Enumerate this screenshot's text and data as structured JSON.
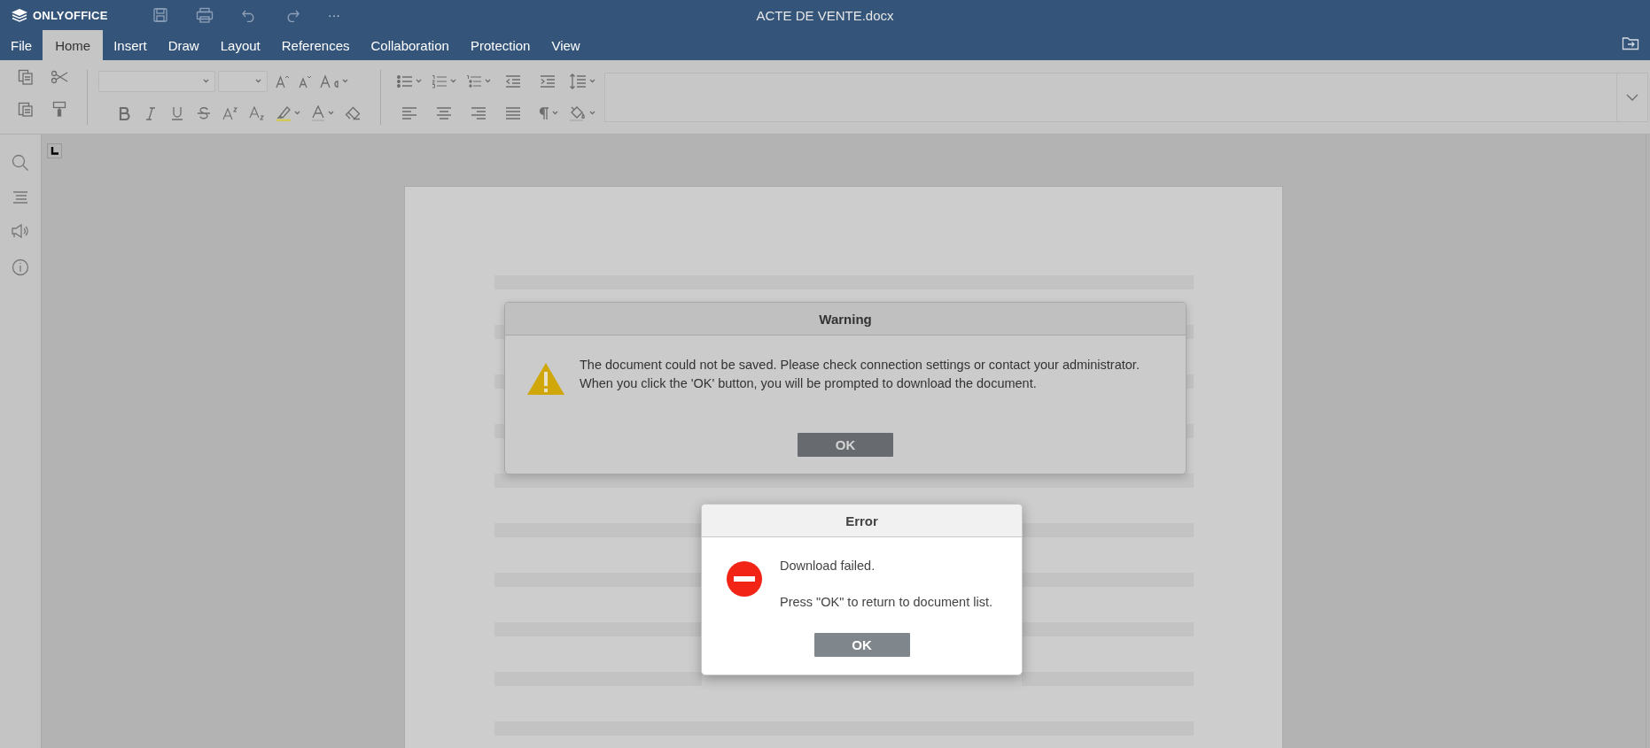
{
  "header": {
    "logo": "ONLYOFFICE",
    "title": "ACTE DE VENTE.docx",
    "more": "···"
  },
  "tabs": [
    {
      "label": "File",
      "selected": false
    },
    {
      "label": "Home",
      "selected": true
    },
    {
      "label": "Insert",
      "selected": false
    },
    {
      "label": "Draw",
      "selected": false
    },
    {
      "label": "Layout",
      "selected": false
    },
    {
      "label": "References",
      "selected": false
    },
    {
      "label": "Collaboration",
      "selected": false
    },
    {
      "label": "Protection",
      "selected": false
    },
    {
      "label": "View",
      "selected": false
    }
  ],
  "dialogs": [
    {
      "kind": "warning",
      "active": false,
      "title": "Warning",
      "messages": [
        "The document could not be saved. Please check connection settings or contact your administrator.",
        "When you click the 'OK' button, you will be prompted to download the document."
      ],
      "button": "OK"
    },
    {
      "kind": "error",
      "active": true,
      "title": "Error",
      "messages": [
        "Download failed.",
        "Press \"OK\" to return to document list."
      ],
      "button": "OK"
    }
  ]
}
